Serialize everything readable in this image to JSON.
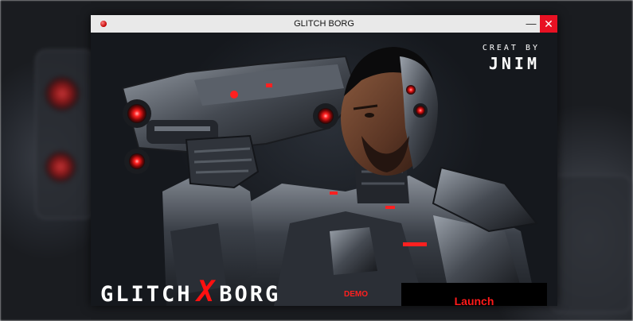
{
  "window": {
    "title": "GLITCH BORG",
    "minimize_glyph": "—",
    "close_glyph": "✕"
  },
  "credit": {
    "label": "CREAT   BY",
    "author": "JNIM"
  },
  "logo": {
    "part1": "GLITCH",
    "x": "X",
    "part2": "BORG",
    "tag": "DEMO"
  },
  "launch_button": {
    "label": "Launch"
  },
  "colors": {
    "accent_red": "#ff1a1a",
    "close_button": "#e81123",
    "titlebar": "#e9e9e9"
  },
  "icons": {
    "app_icon": "red-orb-icon"
  }
}
